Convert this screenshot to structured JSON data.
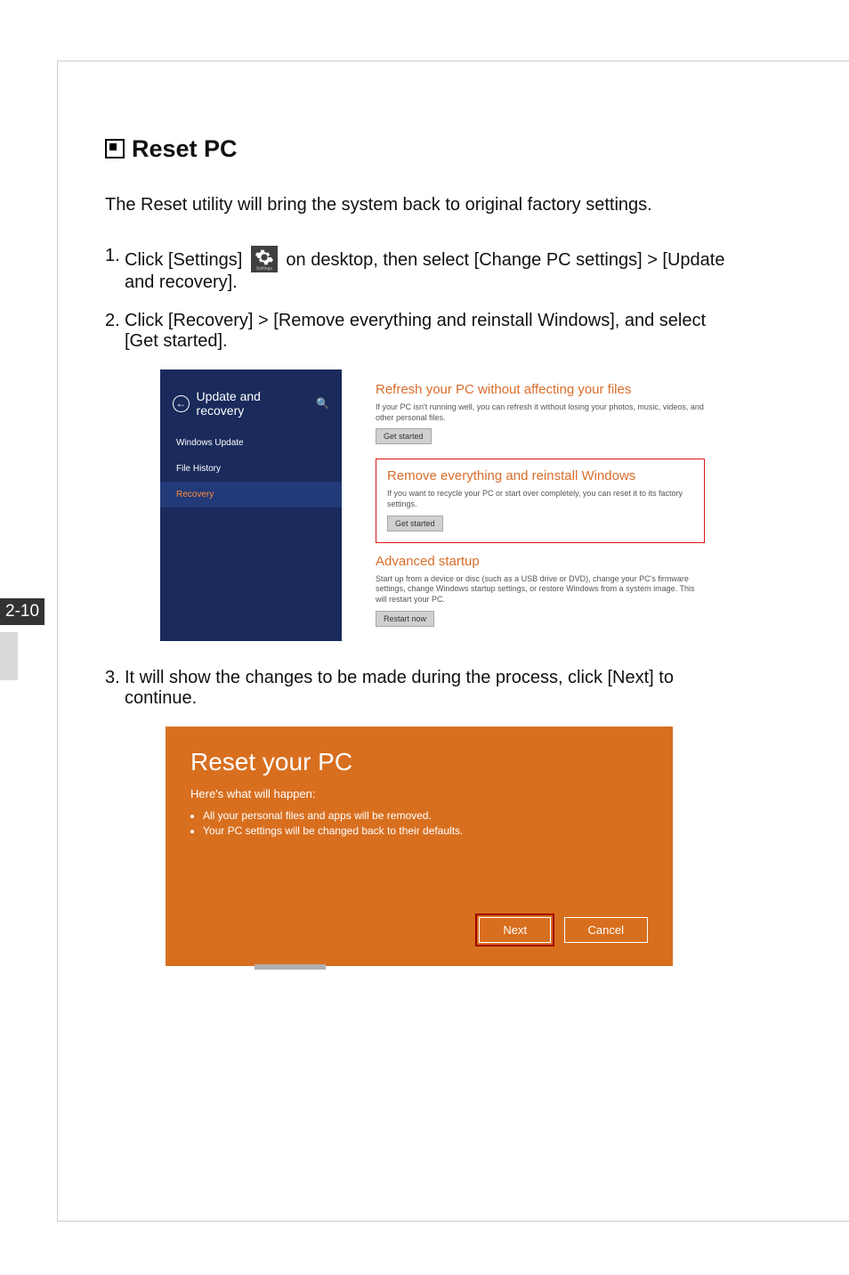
{
  "page_number": "2-10",
  "title": "Reset PC",
  "intro": "The Reset utility will bring the system back to original factory settings.",
  "steps": {
    "s1_num": "1.",
    "s1a": "Click [Settings]",
    "s1b": " on desktop, then select [Change PC settings] > [Update and recovery].",
    "s2_num": "2.",
    "s2": "Click [Recovery] > [Remove everything and reinstall Windows], and select [Get started].",
    "s3_num": "3.",
    "s3": "It will show the changes to be made during the process, click [Next] to continue."
  },
  "settings_tile_label": "Settings",
  "shot1": {
    "header": "Update and recovery",
    "items": [
      "Windows Update",
      "File History",
      "Recovery"
    ],
    "refresh": {
      "title": "Refresh your PC without affecting your files",
      "desc": "If your PC isn't running well, you can refresh it without losing your photos, music, videos, and other personal files.",
      "btn": "Get started"
    },
    "remove": {
      "title": "Remove everything and reinstall Windows",
      "desc": "If you want to recycle your PC or start over completely, you can reset it to its factory settings.",
      "btn": "Get started"
    },
    "advanced": {
      "title": "Advanced startup",
      "desc": "Start up from a device or disc (such as a USB drive or DVD), change your PC's firmware settings, change Windows startup settings, or restore Windows from a system image. This will restart your PC.",
      "btn": "Restart now"
    }
  },
  "shot2": {
    "title": "Reset your PC",
    "sub": "Here's what will happen:",
    "bullets": [
      "All your personal files and apps will be removed.",
      "Your PC settings will be changed back to their defaults."
    ],
    "next": "Next",
    "cancel": "Cancel"
  }
}
